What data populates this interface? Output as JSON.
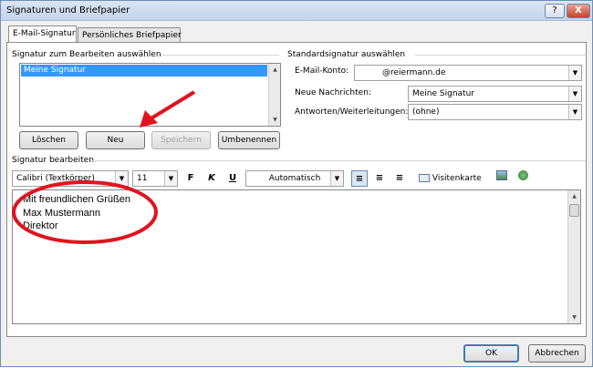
{
  "window": {
    "title": "Signaturen und Briefpapier",
    "help": "?",
    "close": "X"
  },
  "tabs": [
    {
      "label": "E-Mail-Signatur"
    },
    {
      "label": "Persönliches Briefpapier"
    }
  ],
  "select_group": {
    "label": "Signatur zum Bearbeiten auswählen",
    "items": [
      "Meine Signatur"
    ]
  },
  "buttons": {
    "delete": "Löschen",
    "new": "Neu",
    "save": "Speichern",
    "rename": "Umbenennen",
    "ok": "OK",
    "cancel": "Abbrechen"
  },
  "default_group": {
    "label": "Standardsignatur auswählen",
    "account_label": "E-Mail-Konto:",
    "account_value": "@reiermann.de",
    "new_label": "Neue Nachrichten:",
    "new_value": "Meine Signatur",
    "reply_label": "Antworten/Weiterleitungen:",
    "reply_value": "(ohne)"
  },
  "edit_group": {
    "label": "Signatur bearbeiten"
  },
  "toolbar": {
    "font": "Calibri (Textkörper)",
    "size": "11",
    "bold": "F",
    "italic": "K",
    "underline": "U",
    "color": "Automatisch",
    "business_card": "Visitenkarte"
  },
  "signature_lines": [
    "Mit freundlichen Grüßen",
    "Max Mustermann",
    "Direktor"
  ],
  "colors": {
    "annotation": "#e0141e",
    "accent": "#3399ff"
  }
}
